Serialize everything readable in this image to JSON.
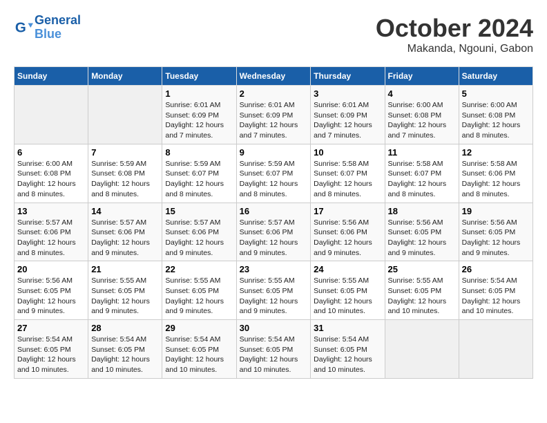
{
  "header": {
    "logo_line1": "General",
    "logo_line2": "Blue",
    "month": "October 2024",
    "location": "Makanda, Ngouni, Gabon"
  },
  "weekdays": [
    "Sunday",
    "Monday",
    "Tuesday",
    "Wednesday",
    "Thursday",
    "Friday",
    "Saturday"
  ],
  "weeks": [
    [
      {
        "day": "",
        "info": ""
      },
      {
        "day": "",
        "info": ""
      },
      {
        "day": "1",
        "info": "Sunrise: 6:01 AM\nSunset: 6:09 PM\nDaylight: 12 hours and 7 minutes."
      },
      {
        "day": "2",
        "info": "Sunrise: 6:01 AM\nSunset: 6:09 PM\nDaylight: 12 hours and 7 minutes."
      },
      {
        "day": "3",
        "info": "Sunrise: 6:01 AM\nSunset: 6:09 PM\nDaylight: 12 hours and 7 minutes."
      },
      {
        "day": "4",
        "info": "Sunrise: 6:00 AM\nSunset: 6:08 PM\nDaylight: 12 hours and 7 minutes."
      },
      {
        "day": "5",
        "info": "Sunrise: 6:00 AM\nSunset: 6:08 PM\nDaylight: 12 hours and 8 minutes."
      }
    ],
    [
      {
        "day": "6",
        "info": "Sunrise: 6:00 AM\nSunset: 6:08 PM\nDaylight: 12 hours and 8 minutes."
      },
      {
        "day": "7",
        "info": "Sunrise: 5:59 AM\nSunset: 6:08 PM\nDaylight: 12 hours and 8 minutes."
      },
      {
        "day": "8",
        "info": "Sunrise: 5:59 AM\nSunset: 6:07 PM\nDaylight: 12 hours and 8 minutes."
      },
      {
        "day": "9",
        "info": "Sunrise: 5:59 AM\nSunset: 6:07 PM\nDaylight: 12 hours and 8 minutes."
      },
      {
        "day": "10",
        "info": "Sunrise: 5:58 AM\nSunset: 6:07 PM\nDaylight: 12 hours and 8 minutes."
      },
      {
        "day": "11",
        "info": "Sunrise: 5:58 AM\nSunset: 6:07 PM\nDaylight: 12 hours and 8 minutes."
      },
      {
        "day": "12",
        "info": "Sunrise: 5:58 AM\nSunset: 6:06 PM\nDaylight: 12 hours and 8 minutes."
      }
    ],
    [
      {
        "day": "13",
        "info": "Sunrise: 5:57 AM\nSunset: 6:06 PM\nDaylight: 12 hours and 8 minutes."
      },
      {
        "day": "14",
        "info": "Sunrise: 5:57 AM\nSunset: 6:06 PM\nDaylight: 12 hours and 9 minutes."
      },
      {
        "day": "15",
        "info": "Sunrise: 5:57 AM\nSunset: 6:06 PM\nDaylight: 12 hours and 9 minutes."
      },
      {
        "day": "16",
        "info": "Sunrise: 5:57 AM\nSunset: 6:06 PM\nDaylight: 12 hours and 9 minutes."
      },
      {
        "day": "17",
        "info": "Sunrise: 5:56 AM\nSunset: 6:06 PM\nDaylight: 12 hours and 9 minutes."
      },
      {
        "day": "18",
        "info": "Sunrise: 5:56 AM\nSunset: 6:05 PM\nDaylight: 12 hours and 9 minutes."
      },
      {
        "day": "19",
        "info": "Sunrise: 5:56 AM\nSunset: 6:05 PM\nDaylight: 12 hours and 9 minutes."
      }
    ],
    [
      {
        "day": "20",
        "info": "Sunrise: 5:56 AM\nSunset: 6:05 PM\nDaylight: 12 hours and 9 minutes."
      },
      {
        "day": "21",
        "info": "Sunrise: 5:55 AM\nSunset: 6:05 PM\nDaylight: 12 hours and 9 minutes."
      },
      {
        "day": "22",
        "info": "Sunrise: 5:55 AM\nSunset: 6:05 PM\nDaylight: 12 hours and 9 minutes."
      },
      {
        "day": "23",
        "info": "Sunrise: 5:55 AM\nSunset: 6:05 PM\nDaylight: 12 hours and 9 minutes."
      },
      {
        "day": "24",
        "info": "Sunrise: 5:55 AM\nSunset: 6:05 PM\nDaylight: 12 hours and 10 minutes."
      },
      {
        "day": "25",
        "info": "Sunrise: 5:55 AM\nSunset: 6:05 PM\nDaylight: 12 hours and 10 minutes."
      },
      {
        "day": "26",
        "info": "Sunrise: 5:54 AM\nSunset: 6:05 PM\nDaylight: 12 hours and 10 minutes."
      }
    ],
    [
      {
        "day": "27",
        "info": "Sunrise: 5:54 AM\nSunset: 6:05 PM\nDaylight: 12 hours and 10 minutes."
      },
      {
        "day": "28",
        "info": "Sunrise: 5:54 AM\nSunset: 6:05 PM\nDaylight: 12 hours and 10 minutes."
      },
      {
        "day": "29",
        "info": "Sunrise: 5:54 AM\nSunset: 6:05 PM\nDaylight: 12 hours and 10 minutes."
      },
      {
        "day": "30",
        "info": "Sunrise: 5:54 AM\nSunset: 6:05 PM\nDaylight: 12 hours and 10 minutes."
      },
      {
        "day": "31",
        "info": "Sunrise: 5:54 AM\nSunset: 6:05 PM\nDaylight: 12 hours and 10 minutes."
      },
      {
        "day": "",
        "info": ""
      },
      {
        "day": "",
        "info": ""
      }
    ]
  ]
}
